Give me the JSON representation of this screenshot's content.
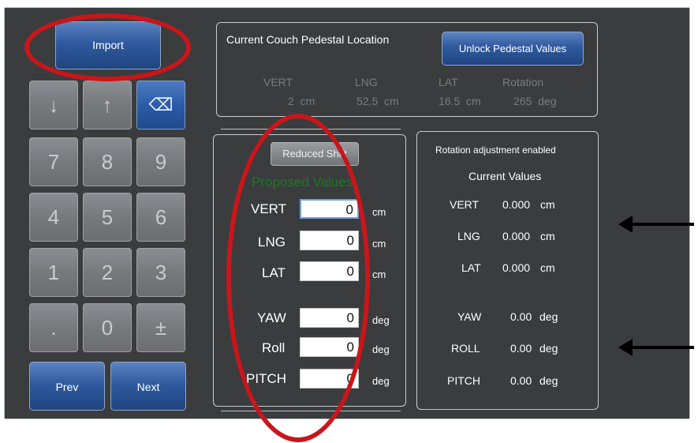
{
  "toolbar": {
    "import_label": "Import",
    "prev_label": "Prev",
    "next_label": "Next"
  },
  "keypad": {
    "down": "↓",
    "up": "↑",
    "backspace": "⌫",
    "k7": "7",
    "k8": "8",
    "k9": "9",
    "k4": "4",
    "k5": "5",
    "k6": "6",
    "k1": "1",
    "k2": "2",
    "k3": "3",
    "dot": ".",
    "k0": "0",
    "plusminus": "±"
  },
  "pedestal": {
    "title": "Current Couch Pedestal Location",
    "unlock_label": "Unlock Pedestal Values",
    "headers": [
      "VERT",
      "LNG",
      "LAT",
      "Rotation"
    ],
    "values": [
      "2  cm",
      "52.5  cm",
      "16.5  cm",
      "265  deg"
    ]
  },
  "proposed": {
    "reduced_shift_label": "Reduced Shift",
    "title": "Proposed Values",
    "rows": [
      {
        "label": "VERT",
        "value": "0",
        "unit": "cm"
      },
      {
        "label": "LNG",
        "value": "0",
        "unit": "cm"
      },
      {
        "label": "LAT",
        "value": "0",
        "unit": "cm"
      },
      {
        "label": "YAW",
        "value": "0",
        "unit": "deg"
      },
      {
        "label": "Roll",
        "value": "0",
        "unit": "deg"
      },
      {
        "label": "PITCH",
        "value": "0",
        "unit": "deg"
      }
    ]
  },
  "current": {
    "notice": "Rotation adjustment enabled",
    "title": "Current Values",
    "rows": [
      {
        "label": "VERT",
        "value": "0.000",
        "unit": "cm"
      },
      {
        "label": "LNG",
        "value": "0.000",
        "unit": "cm"
      },
      {
        "label": "LAT",
        "value": "0.000",
        "unit": "cm"
      },
      {
        "label": "YAW",
        "value": "0.00",
        "unit": "deg"
      },
      {
        "label": "ROLL",
        "value": "0.00",
        "unit": "deg"
      },
      {
        "label": "PITCH",
        "value": "0.00",
        "unit": "deg"
      }
    ]
  },
  "colors": {
    "panel": "#3a3c3e",
    "accent_blue": "#2f5a9e",
    "proposed_green": "#1e7a1e",
    "annotation_red": "#c8161b"
  }
}
